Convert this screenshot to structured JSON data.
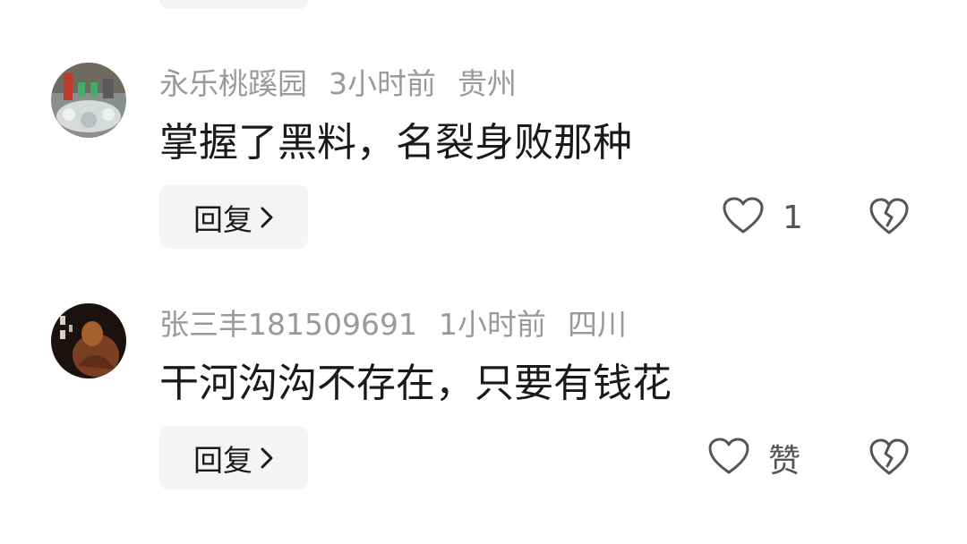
{
  "comments": [
    {
      "username": "永乐桃蹊园",
      "time": "3小时前",
      "location": "贵州",
      "content": "掌握了黑料，名裂身败那种",
      "reply_label": "回复",
      "like_text": "1"
    },
    {
      "username": "张三丰181509691",
      "time": "1小时前",
      "location": "四川",
      "content": "干河沟沟不存在，只要有钱花",
      "reply_label": "回复",
      "like_text": "赞"
    }
  ],
  "icons": {
    "like": "heart-outline-icon",
    "dislike": "broken-heart-icon",
    "reply_arrow": "chevron-right-icon"
  },
  "colors": {
    "meta_text": "#9a9a9a",
    "content_text": "#1a1a1a",
    "button_bg": "#f3f4f6",
    "icon_stroke": "#555555"
  }
}
